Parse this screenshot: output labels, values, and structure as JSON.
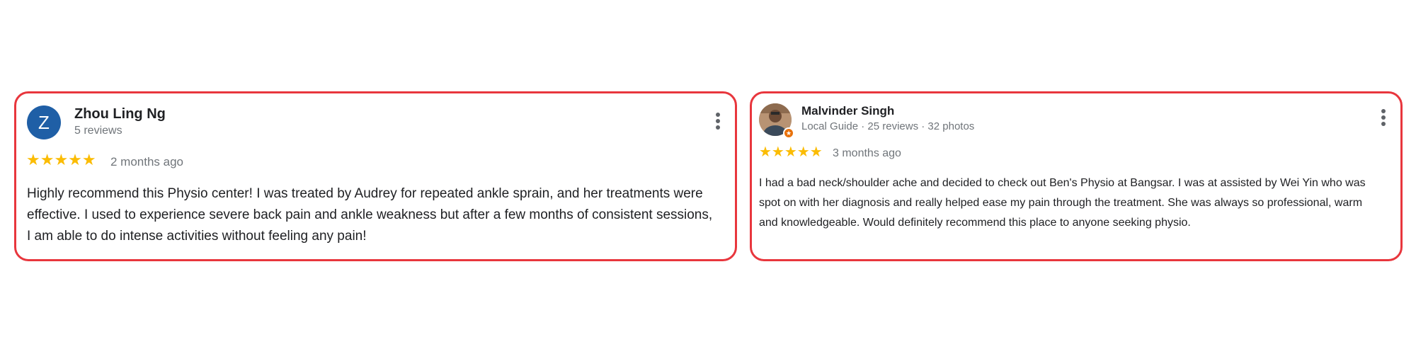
{
  "reviews": [
    {
      "avatar_letter": "Z",
      "avatar_color": "#1f5fa6",
      "name": "Zhou Ling Ng",
      "meta": "5 reviews",
      "stars": "★★★★★",
      "rating": 5,
      "time": "2 months ago",
      "text": "Highly recommend this Physio center! I was treated by Audrey for repeated ankle sprain, and her treatments were effective. I used to experience severe back pain and ankle weakness but after a few months of consistent sessions, I am able to do intense activities without feeling any pain!",
      "menu_icon": "more-vert-icon"
    },
    {
      "avatar_icon": "profile-photo",
      "badge_icon": "local-guide-star-icon",
      "badge_color": "#e8710a",
      "name": "Malvinder Singh",
      "meta": "Local Guide · 25 reviews · 32 photos",
      "stars": "★★★★★",
      "rating": 5,
      "time": "3 months ago",
      "text": "I had a bad neck/shoulder ache and decided to check out Ben's Physio at Bangsar. I was at assisted by Wei Yin who was spot on with her diagnosis and really helped ease my pain through the treatment. She was always so professional, warm and knowledgeable. Would definitely recommend this place to anyone seeking physio.",
      "menu_icon": "more-vert-icon"
    }
  ],
  "highlight_color": "#e8363d",
  "star_color": "#fbbc04"
}
